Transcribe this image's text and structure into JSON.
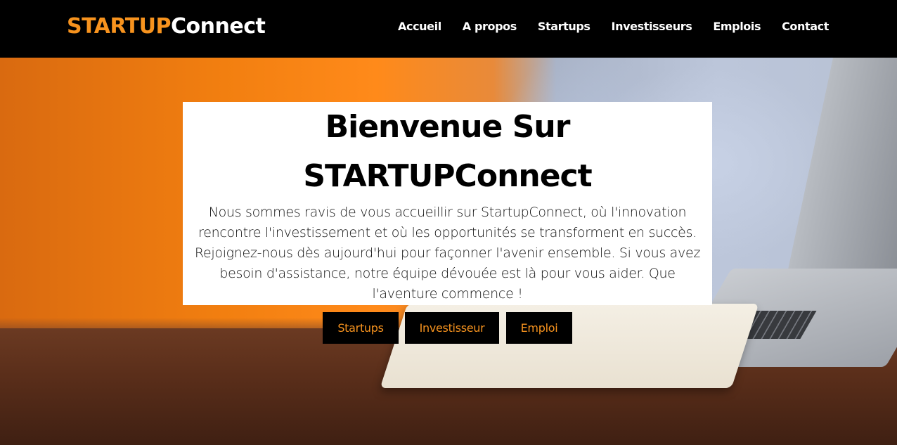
{
  "header": {
    "logo": {
      "part1": "STARTUP",
      "part2": "Connect"
    },
    "nav": [
      {
        "label": "Accueil"
      },
      {
        "label": "A propos"
      },
      {
        "label": "Startups"
      },
      {
        "label": "Investisseurs"
      },
      {
        "label": "Emplois"
      },
      {
        "label": "Contact"
      }
    ]
  },
  "hero": {
    "title_line1": "Bienvenue Sur",
    "title_line2": "STARTUPConnect",
    "description": "Nous sommes ravis de vous accueillir sur StartupConnect, où l'innovation rencontre l'investissement et où les opportunités se transforment en succès. Rejoignez-nous dès aujourd'hui pour façonner l'avenir ensemble. Si vous avez besoin d'assistance, notre équipe dévouée est là pour vous aider. Que l'aventure commence !",
    "buttons": [
      {
        "label": "Startups"
      },
      {
        "label": "Investisseur"
      },
      {
        "label": "Emploi"
      }
    ]
  },
  "colors": {
    "accent": "#f7931e",
    "navbar_bg": "#000000",
    "card_bg": "#ffffff"
  }
}
